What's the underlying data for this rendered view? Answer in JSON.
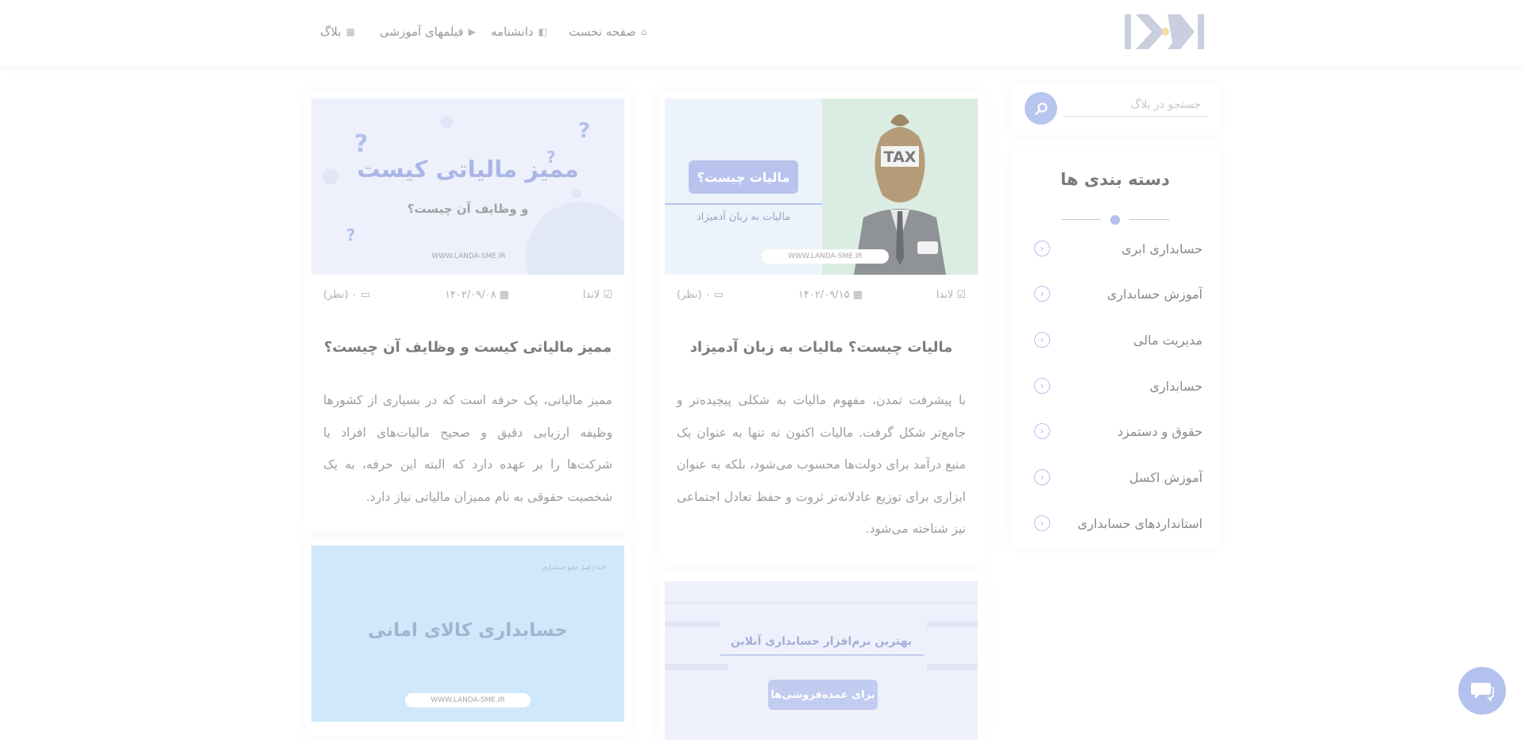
{
  "header": {
    "logo_alt": "landa",
    "nav": [
      {
        "label": "صفحه نخست",
        "icon": "home-icon"
      },
      {
        "label": "دانشنامه",
        "icon": "book-icon"
      },
      {
        "label": "فیلمهای آموزشی",
        "icon": "video-icon"
      },
      {
        "label": "بلاگ",
        "icon": "calendar-icon"
      }
    ]
  },
  "sidebar": {
    "search_placeholder": "جستجو در بلاگ",
    "categories_title": "دسته بندی ها",
    "categories": [
      "حسابداری ابری",
      "آموزش حسابداری",
      "مدیریت مالی",
      "حسابداری",
      "حقوق و دستمزد",
      "آموزش اکسل",
      "استانداردهای حسابداری"
    ]
  },
  "posts": [
    {
      "author": "لاندا",
      "date": "۱۴۰۲/۰۹/۱۵",
      "comments": "۰ (نظر)",
      "title": "مالیات چیست؟ مالیات به زبان آدمیزاد",
      "excerpt": "با پیشرفت تمدن، مفهوم مالیات به شکلی پیچیده‌تر و جامع‌تر شکل گرفت. مالیات اکنون نه تنها به عنوان یک منبع درآمد برای دولت‌ها محسوب می‌شود، بلکه به عنوان ابزاری برای توزیع عادلانه‌تر ثروت و حفظ تعادل اجتماعی نیز شناخته می‌شود.",
      "thumb": {
        "badge": "مالیات چیست؟",
        "subtitle": "مالیات به زبان آدمیزاد",
        "tax": "TAX",
        "url": "WWW.LANDA-SME.IR"
      }
    },
    {
      "author": "لاندا",
      "date": "۱۴۰۲/۰۹/۰۸",
      "comments": "۰ (نظر)",
      "title": "ممیز مالیاتی کیست و وظایف آن چیست؟",
      "excerpt": "ممیز مالیاتی، یک حرفه است که در بسیاری از کشورها وظیفه ارزیابی دقیق و صحیح مالیات‌های افراد یا شرکت‌ها را بر عهده دارد که البته این حرفه، به یک شخصیت حقوقی به نام ممیزان مالیاتی نیاز دارد.",
      "thumb": {
        "title": "ممیز مالیاتی کیست",
        "subtitle": "و وظایف آن چیست؟",
        "url": "WWW.LANDA-SME.IR",
        "q": "?"
      }
    },
    {
      "thumb": {
        "title": "بهترین نرم‌افزار حسابداری آنلاین",
        "badge": "برای عمده‌فروشی‌ها"
      }
    },
    {
      "thumb": {
        "title": "حسابداری کالای امانی",
        "top_note": "لاندا | اصل جامع حسابداری",
        "url": "WWW.LANDA-SME.IR"
      }
    }
  ],
  "colors": {
    "accent": "#b3c1ee",
    "thumb_green": "#d7ebe1",
    "thumb_lavender": "#e9ecfa",
    "thumb_blue": "#cfe8fb"
  }
}
